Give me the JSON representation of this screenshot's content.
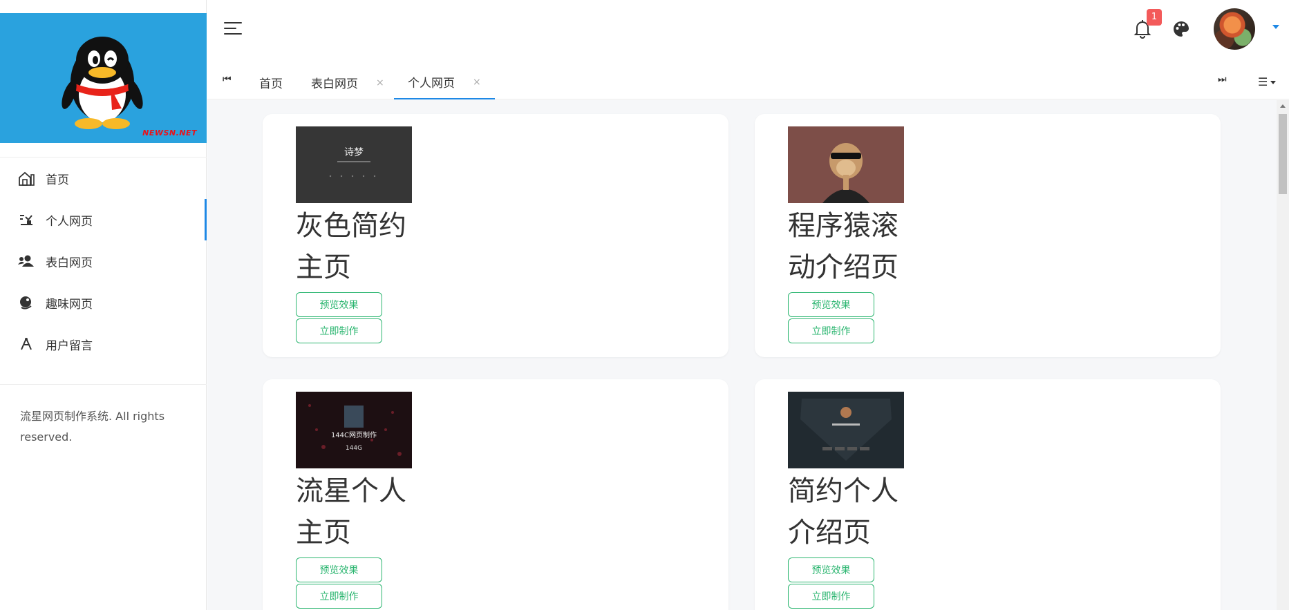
{
  "sidebar": {
    "logo_mark": "NEWSN.NET",
    "items": [
      {
        "label": "首页",
        "icon": "home-icon"
      },
      {
        "label": "个人网页",
        "icon": "person-page-icon",
        "active": true
      },
      {
        "label": "表白网页",
        "icon": "users-icon"
      },
      {
        "label": "趣味网页",
        "icon": "globe-icon"
      },
      {
        "label": "用户留言",
        "icon": "compass-icon"
      }
    ],
    "copyright": "流星网页制作系统. All rights reserved."
  },
  "header": {
    "notification_count": "1",
    "accent_color": "#1e88e5"
  },
  "tabs": {
    "items": [
      {
        "label": "首页",
        "closable": false
      },
      {
        "label": "表白网页",
        "closable": true
      },
      {
        "label": "个人网页",
        "closable": true,
        "active": true
      }
    ],
    "close_glyph": "×"
  },
  "cards": [
    {
      "title": "灰色简约主页",
      "thumb_text": "诗梦",
      "preview_label": "预览效果",
      "make_label": "立即制作"
    },
    {
      "title": "程序猿滚动介绍页",
      "thumb_text": "",
      "preview_label": "预览效果",
      "make_label": "立即制作"
    },
    {
      "title": "流星个人主页",
      "thumb_text": "144C网页制作",
      "thumb_sub": "144G",
      "preview_label": "预览效果",
      "make_label": "立即制作"
    },
    {
      "title": "简约个人介绍页",
      "thumb_text": "",
      "preview_label": "预览效果",
      "make_label": "立即制作"
    }
  ],
  "colors": {
    "sidebar_logo_bg": "#2aa2de",
    "button_green": "#2ab56f",
    "badge_red": "#f35a5a"
  }
}
